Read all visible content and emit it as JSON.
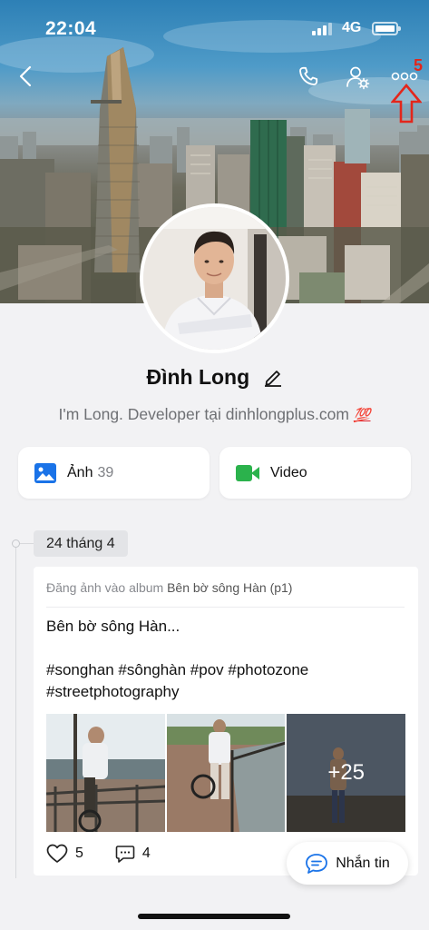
{
  "status_bar": {
    "time": "22:04",
    "network": "4G"
  },
  "header": {
    "annotation_number": "5"
  },
  "profile": {
    "name": "Đình Long",
    "bio": "I'm Long. Developer tại dinhlongplus.com",
    "bio_emoji": "💯"
  },
  "media": {
    "photos_label": "Ảnh",
    "photos_count": "39",
    "video_label": "Video"
  },
  "timeline": {
    "date": "24 tháng 4",
    "post": {
      "meta_prefix": "Đăng ảnh vào album",
      "album": "Bên bờ sông Hàn (p1)",
      "text_line1": "Bên bờ sông Hàn...",
      "text_line2": "#songhan #sônghàn #pov #photozone",
      "text_line3": "#streetphotography",
      "more_photos": "+25",
      "likes": "5",
      "comments": "4"
    }
  },
  "chat_button": {
    "label": "Nhắn tin"
  },
  "colors": {
    "accent_blue": "#1a73e8",
    "video_green": "#2bb24c",
    "annotation_red": "#e3261b",
    "background": "#f2f2f4"
  }
}
